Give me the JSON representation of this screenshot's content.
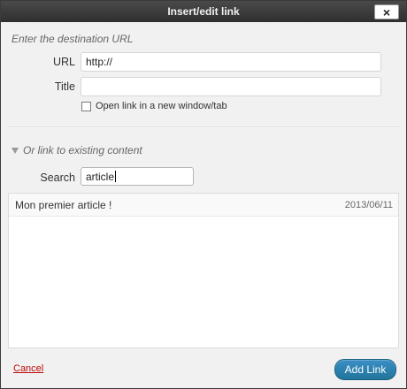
{
  "dialog": {
    "title": "Insert/edit link",
    "close_symbol": "×"
  },
  "destination": {
    "heading": "Enter the destination URL",
    "url_label": "URL",
    "url_value": "http://",
    "title_label": "Title",
    "title_value": "",
    "new_window_label": "Open link in a new window/tab",
    "new_window_checked": false
  },
  "existing": {
    "toggle_label": "Or link to existing content",
    "search_label": "Search",
    "search_value": "article",
    "results": [
      {
        "title": "Mon premier article !",
        "date": "2013/06/11"
      }
    ]
  },
  "footer": {
    "cancel_label": "Cancel",
    "add_label": "Add Link"
  },
  "colors": {
    "accent": "#21759b",
    "cancel": "#bc0b0b"
  }
}
